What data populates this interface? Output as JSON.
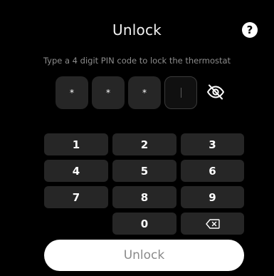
{
  "header": {
    "title": "Unlock",
    "help_icon": "question-circle-icon",
    "help_label": "?"
  },
  "subtitle": "Type a 4 digit PIN code to lock the thermostat",
  "pin": {
    "digits": [
      "*",
      "*",
      "*",
      ""
    ],
    "active_index": 3,
    "visibility_icon": "eye-off-icon"
  },
  "keypad": {
    "keys": [
      "1",
      "2",
      "3",
      "4",
      "5",
      "6",
      "7",
      "8",
      "9",
      "",
      "0"
    ],
    "backspace_icon": "backspace-icon"
  },
  "unlock_button": {
    "label": "Unlock"
  },
  "colors": {
    "background": "#000000",
    "key_background": "#262626",
    "button_background": "#ffffff",
    "subtitle_text": "#8c8c8c",
    "button_text": "#8a8a8a"
  }
}
